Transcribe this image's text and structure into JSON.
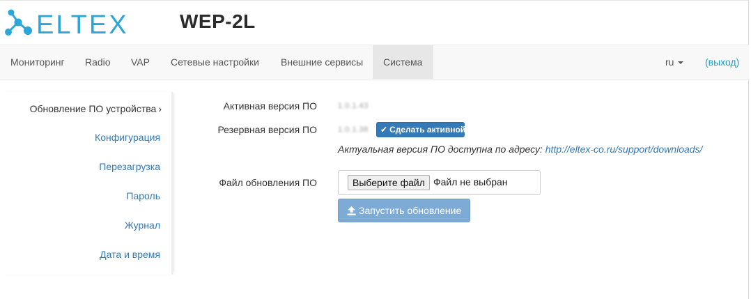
{
  "header": {
    "brand": "ELTEX",
    "product": "WEP-2L"
  },
  "navbar": {
    "items": [
      {
        "label": "Мониторинг"
      },
      {
        "label": "Radio"
      },
      {
        "label": "VAP"
      },
      {
        "label": "Сетевые настройки"
      },
      {
        "label": "Внешние сервисы"
      },
      {
        "label": "Система",
        "active": true
      }
    ],
    "language": "ru",
    "logout": "(выход)"
  },
  "sidebar": {
    "items": [
      {
        "label": "Обновление ПО устройства",
        "active": true,
        "chevron": "›"
      },
      {
        "label": "Конфигурация"
      },
      {
        "label": "Перезагрузка"
      },
      {
        "label": "Пароль"
      },
      {
        "label": "Журнал"
      },
      {
        "label": "Дата и время"
      }
    ]
  },
  "firmware": {
    "active_label": "Активная версия ПО",
    "active_value": "1.0.1.43",
    "backup_label": "Резервная версия ПО",
    "backup_value": "1.0.1.38",
    "make_active_button": "Сделать активной",
    "hint_text": "Актуальная версия ПО доступна по адресу: ",
    "hint_link": "http://eltex-co.ru/support/downloads/",
    "file_label": "Файл обновления ПО",
    "choose_file_button": "Выберите файл",
    "file_status": "Файл не выбран",
    "start_update_button": "Запустить обновление"
  },
  "colors": {
    "brand": "#2aa6d8",
    "link": "#337ab7",
    "primary_button": "#337ab7",
    "disabled_button": "#7eaad6",
    "logout": "#1ba0c8"
  },
  "icons": {
    "logo": "eltex-logo-icon",
    "check": "check-icon",
    "upload": "upload-icon",
    "caret": "caret-down-icon"
  }
}
